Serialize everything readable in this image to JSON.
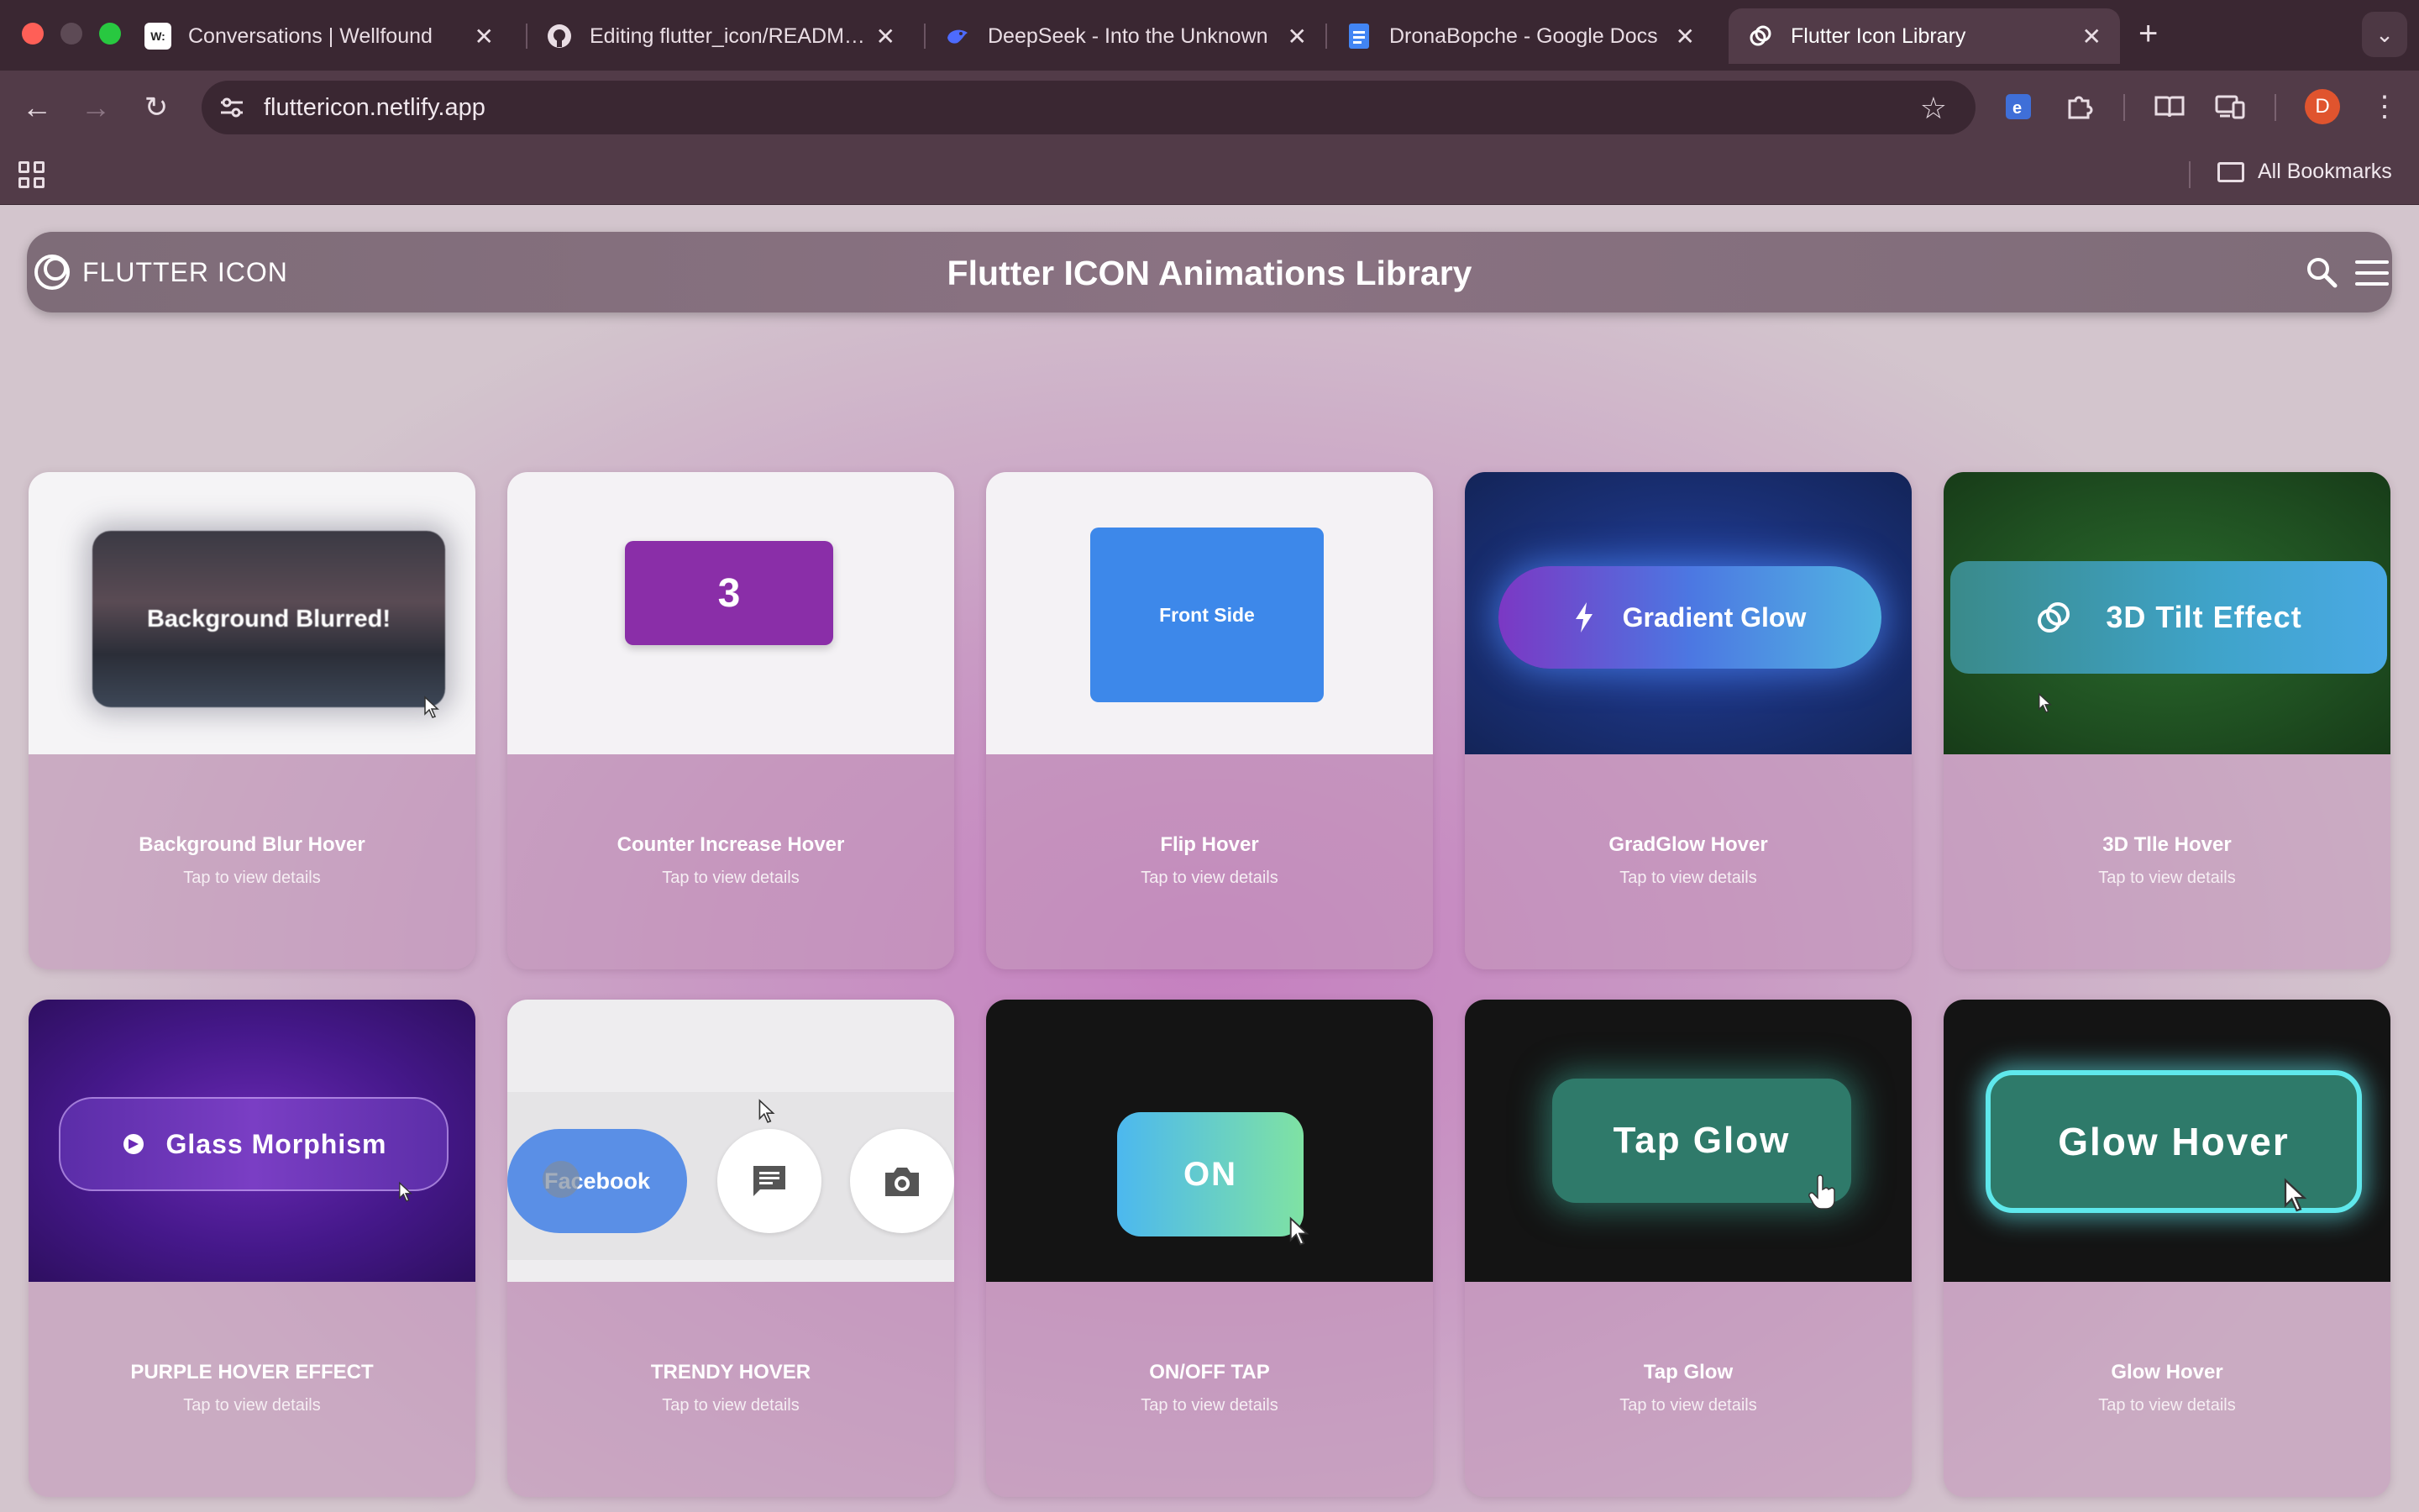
{
  "browser": {
    "tabs": [
      {
        "title": "Conversations | Wellfound",
        "favicon": "W:",
        "active": false
      },
      {
        "title": "Editing flutter_icon/README.md",
        "favicon": "github-icon",
        "active": false
      },
      {
        "title": "DeepSeek - Into the Unknown",
        "favicon": "deepseek-icon",
        "active": false
      },
      {
        "title": "DronaBopche - Google Docs",
        "favicon": "docs-icon",
        "active": false
      },
      {
        "title": "Flutter Icon Library",
        "favicon": "flutter-icon-logo",
        "active": true
      }
    ],
    "url": "fluttericon.netlify.app",
    "all_bookmarks": "All Bookmarks",
    "profile_initial": "D"
  },
  "app": {
    "brand": "FLUTTER ICON",
    "title": "Flutter ICON Animations Library"
  },
  "cards": [
    {
      "title": "Background Blur Hover",
      "subtitle": "Tap to view details",
      "preview_label": "Background Blurred!"
    },
    {
      "title": "Counter Increase Hover",
      "subtitle": "Tap to view details",
      "preview_label": "3"
    },
    {
      "title": "Flip Hover",
      "subtitle": "Tap to view details",
      "preview_label": "Front Side"
    },
    {
      "title": "GradGlow Hover",
      "subtitle": "Tap to view details",
      "preview_label": "Gradient Glow"
    },
    {
      "title": "3D Tlle Hover",
      "subtitle": "Tap to view details",
      "preview_label": "3D Tilt Effect"
    },
    {
      "title": "PURPLE HOVER EFFECT",
      "subtitle": "Tap to view details",
      "preview_label": "Glass Morphism"
    },
    {
      "title": "TRENDY HOVER",
      "subtitle": "Tap to view details",
      "preview_label": "Facebook"
    },
    {
      "title": "ON/OFF TAP",
      "subtitle": "Tap to view details",
      "preview_label": "ON"
    },
    {
      "title": "Tap Glow",
      "subtitle": "Tap to view details",
      "preview_label": "Tap Glow"
    },
    {
      "title": "Glow Hover",
      "subtitle": "Tap to view details",
      "preview_label": "Glow Hover"
    }
  ],
  "colors": {
    "page_accent": "#c57fc0",
    "appbar": "#7e6c78",
    "counter": "#8a2ea8",
    "flip": "#3d88ea",
    "glow_border": "#5fe8ec"
  }
}
